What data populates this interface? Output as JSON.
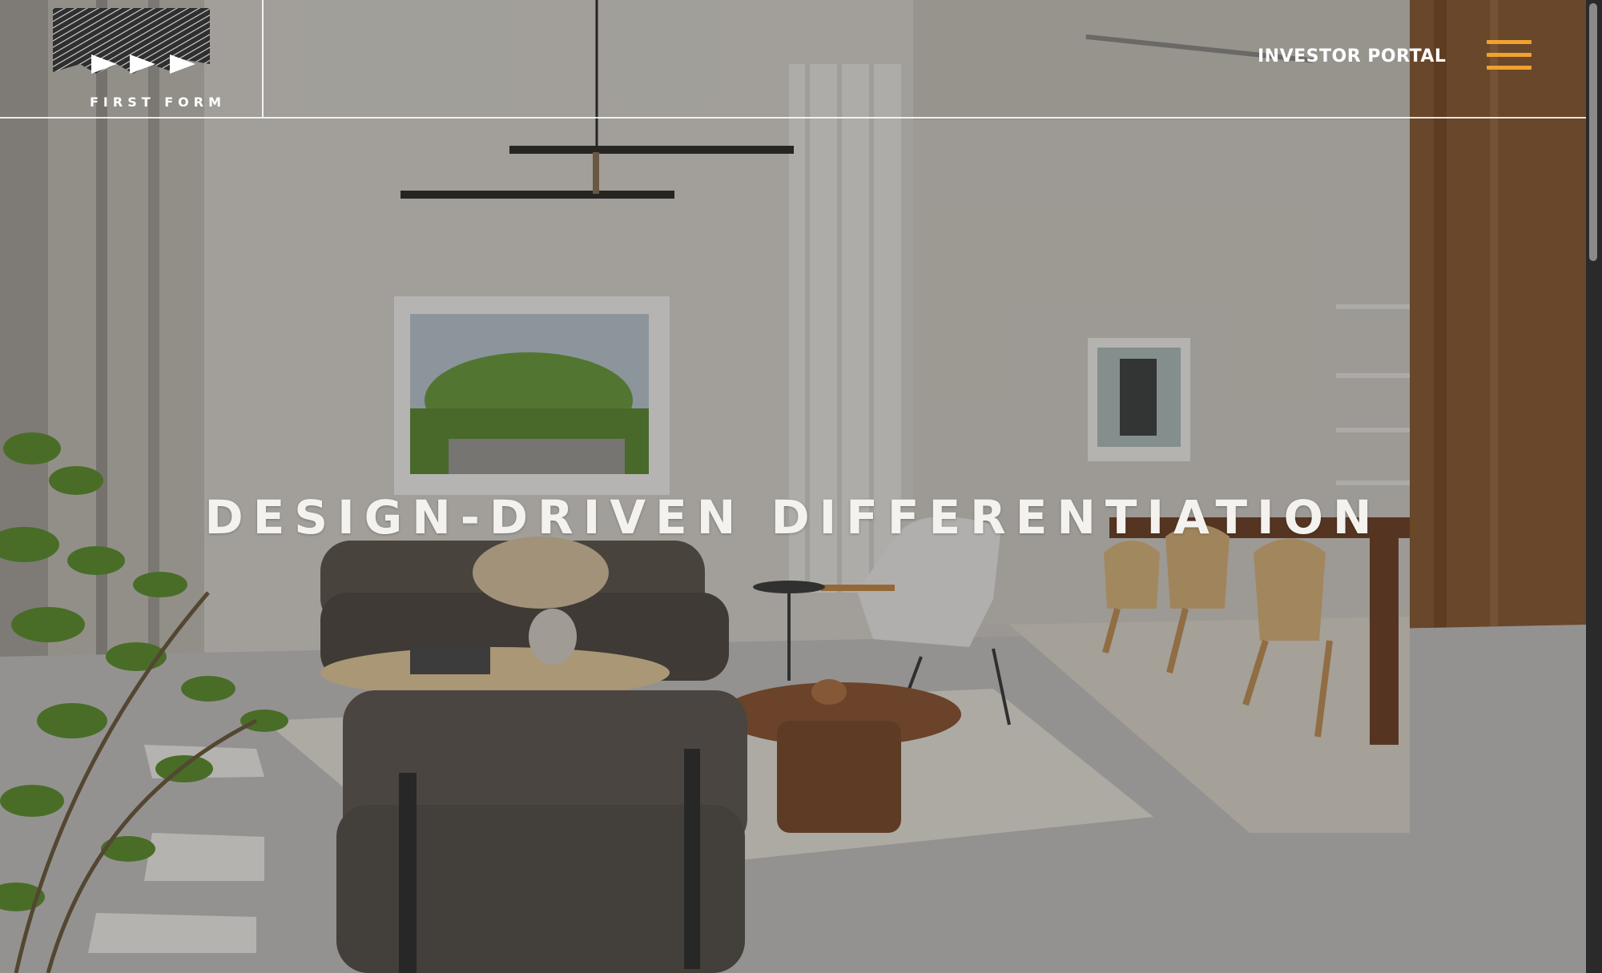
{
  "brand": {
    "name": "FIRST FORM"
  },
  "header": {
    "investor_portal_label": "INVESTOR PORTAL",
    "menu_icon": "hamburger-menu-icon"
  },
  "hero": {
    "title": "DESIGN-DRIVEN DIFFERENTIATION"
  },
  "colors": {
    "accent": "#f0a22e",
    "text": "#ffffff"
  }
}
